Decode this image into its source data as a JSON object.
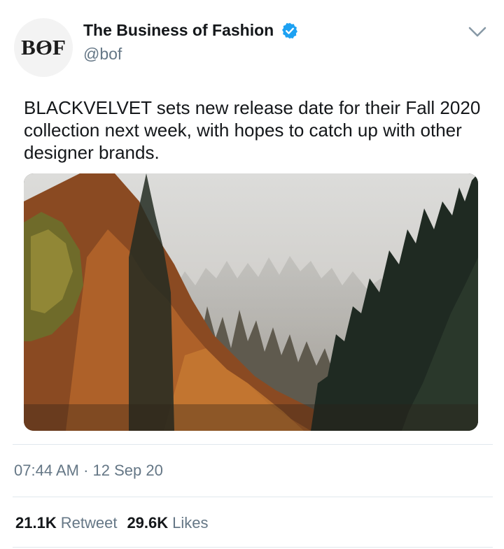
{
  "author": {
    "logo_text": "BOF",
    "display_name": "The Business of Fashion",
    "handle": "@bof",
    "verified_icon": "verified-badge-icon",
    "verified_color": "#1DA1F2"
  },
  "tweet": {
    "text": "BLACKVELVET sets new release date for their Fall 2020 collection next week, with hopes to catch up with other designer brands.",
    "media_description_icon": "photo-forest-autumn"
  },
  "meta": {
    "time": "07:44 AM",
    "separator": "·",
    "date": "12 Sep 20"
  },
  "stats": {
    "retweets_count": "21.1K",
    "retweets_label": "Retweet",
    "likes_count": "29.6K",
    "likes_label": "Likes"
  },
  "colors": {
    "text": "#14171a",
    "secondary": "#657786",
    "divider": "#e1e8ed",
    "accent": "#1DA1F2"
  }
}
